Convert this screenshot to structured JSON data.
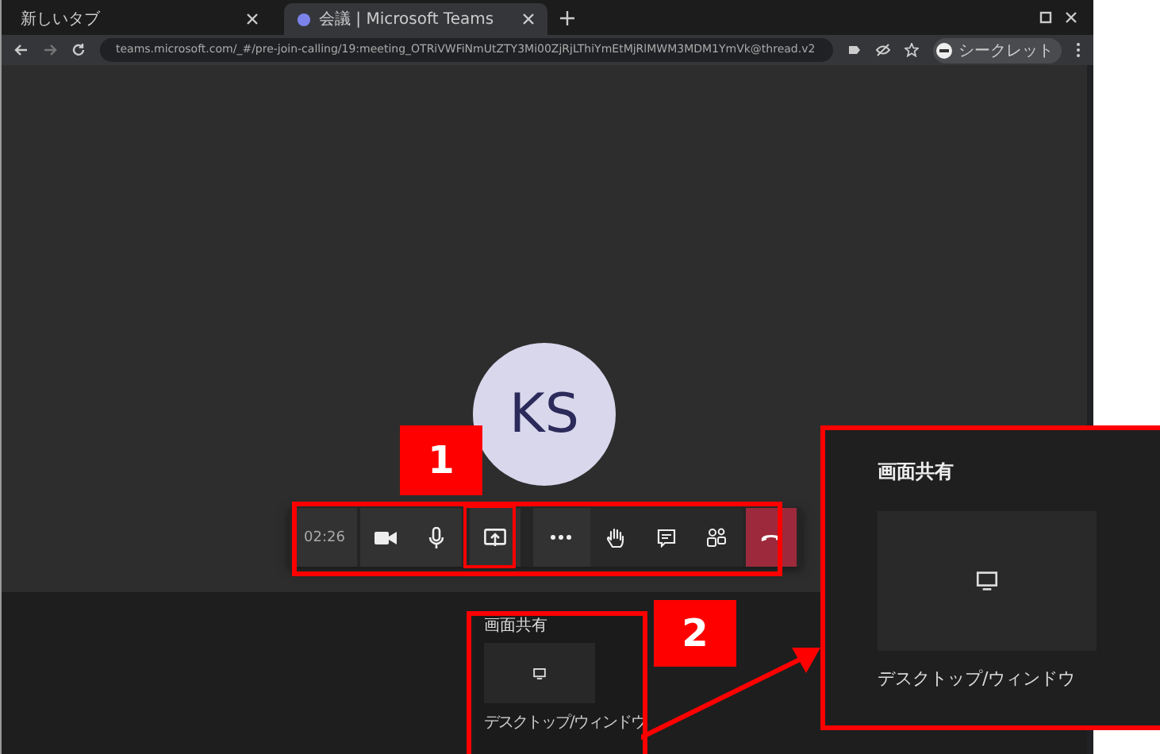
{
  "browser": {
    "tabs": [
      {
        "title": "新しいタブ",
        "selected": false
      },
      {
        "title": "会議 | Microsoft Teams",
        "selected": true
      }
    ],
    "address": "teams.microsoft.com/_#/pre-join-calling/19:meeting_OTRiVWFiNmUtZTY3Mi00ZjRjLThiYmEtMjRlMWM3MDM1YmVk@thread.v2",
    "profile": "シークレット"
  },
  "meeting": {
    "avatar_initials": "KS",
    "toolbar": [
      {
        "kind": "timer",
        "label": "02:26"
      },
      {
        "kind": "camera"
      },
      {
        "kind": "mic"
      },
      {
        "kind": "share"
      },
      {
        "kind": "more"
      },
      {
        "kind": "hand"
      },
      {
        "kind": "chat"
      },
      {
        "kind": "people"
      },
      {
        "kind": "hangup"
      }
    ]
  },
  "share_panel": {
    "title": "画面共有",
    "option": "デスクトップ/ウィンドウ"
  },
  "callouts": [
    {
      "number": "1"
    },
    {
      "number": "2"
    }
  ],
  "zoomed_panel": {
    "title": "画面共有",
    "option": "デスクトップ/ウィンドウ"
  }
}
